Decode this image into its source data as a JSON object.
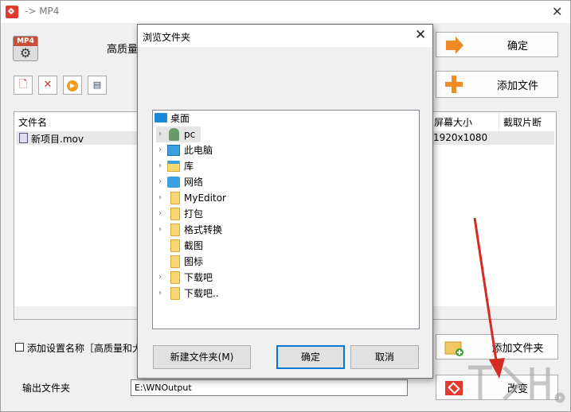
{
  "window": {
    "title": "-> MP4"
  },
  "main": {
    "quality_label": "高质量和",
    "confirm_label": "确定",
    "add_file_label": "添加文件",
    "toolbar_icons": [
      "clear-list-icon",
      "remove-item-icon",
      "play-icon",
      "info-icon"
    ],
    "list": {
      "columns": [
        "文件名",
        "屏幕大小",
        "截取片断"
      ],
      "rows": [
        {
          "name": "新项目.mov",
          "resolution": "1920x1080"
        }
      ]
    },
    "add_setting_label": "添加设置名称［高质量和大",
    "add_folder_label": "添加文件夹",
    "output_folder_label": "输出文件夹",
    "output_folder_value": "E:\\WNOutput",
    "change_label": "改变"
  },
  "dialog": {
    "title": "浏览文件夹",
    "tree": [
      {
        "label": "桌面",
        "icon": "desktop-icon",
        "level": 0,
        "expandable": false
      },
      {
        "label": "pc",
        "icon": "user-icon",
        "level": 1,
        "expandable": true
      },
      {
        "label": "此电脑",
        "icon": "computer-icon",
        "level": 1,
        "expandable": true
      },
      {
        "label": "库",
        "icon": "library-icon",
        "level": 1,
        "expandable": true
      },
      {
        "label": "网络",
        "icon": "network-icon",
        "level": 1,
        "expandable": true
      },
      {
        "label": "MyEditor",
        "icon": "folder-icon",
        "level": 1,
        "expandable": true
      },
      {
        "label": "打包",
        "icon": "folder-icon",
        "level": 1,
        "expandable": true
      },
      {
        "label": "格式转换",
        "icon": "folder-icon",
        "level": 1,
        "expandable": true
      },
      {
        "label": "截图",
        "icon": "folder-icon",
        "level": 1,
        "expandable": false
      },
      {
        "label": "图标",
        "icon": "folder-icon",
        "level": 1,
        "expandable": false
      },
      {
        "label": "下载吧",
        "icon": "folder-icon",
        "level": 1,
        "expandable": true
      },
      {
        "label": "下载吧..",
        "icon": "folder-icon",
        "level": 1,
        "expandable": true
      }
    ],
    "new_folder_label": "新建文件夹(M)",
    "ok_label": "确定",
    "cancel_label": "取消"
  },
  "colors": {
    "accent": "#0078d7",
    "arrow": "#d62a22",
    "logo": "#e23b2e"
  }
}
